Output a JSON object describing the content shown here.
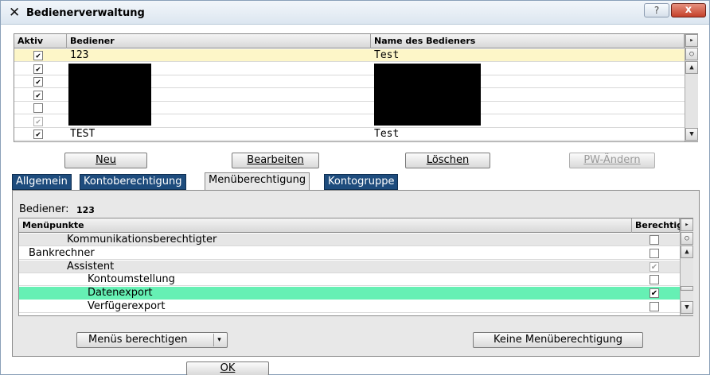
{
  "window": {
    "title": "Bedienerverwaltung",
    "help_label": "?",
    "close_label": "x"
  },
  "users_grid": {
    "columns": {
      "active": "Aktiv",
      "user": "Bediener",
      "name": "Name des Bedieners"
    },
    "rows": [
      {
        "active": true,
        "disabled": false,
        "user": "123",
        "name": "Test",
        "selected": true
      },
      {
        "active": true,
        "disabled": false,
        "user": "",
        "name": "",
        "selected": false
      },
      {
        "active": true,
        "disabled": false,
        "user": "",
        "name": "",
        "selected": false
      },
      {
        "active": true,
        "disabled": false,
        "user": "",
        "name": "",
        "selected": false
      },
      {
        "active": false,
        "disabled": false,
        "user": "",
        "name": "",
        "selected": false
      },
      {
        "active": true,
        "disabled": true,
        "user": "",
        "name": "",
        "selected": false
      },
      {
        "active": true,
        "disabled": false,
        "user": "TEST",
        "name": "Test",
        "selected": false
      }
    ]
  },
  "actions": {
    "new": "Neu",
    "edit": "Bearbeiten",
    "delete": "Löschen",
    "pw_change": "PW-Ändern"
  },
  "tabs": [
    {
      "label": "Allgemein",
      "active": false
    },
    {
      "label": "Kontoberechtigung",
      "active": false
    },
    {
      "label": "Menüberechtigung",
      "active": true
    },
    {
      "label": "Kontogruppe",
      "active": false
    }
  ],
  "panel": {
    "user_label": "Bediener:",
    "user_value": "123",
    "menu_grid": {
      "columns": {
        "item": "Menüpunkte",
        "allowed": "Berechtigt"
      },
      "rows": [
        {
          "label": "Kommunikationsberechtigter",
          "allowed": false,
          "disabled": false,
          "selected": false
        },
        {
          "label": "Bankrechner",
          "allowed": false,
          "disabled": false,
          "selected": false
        },
        {
          "label": "Assistent",
          "allowed": true,
          "disabled": true,
          "selected": false
        },
        {
          "label": "Kontoumstellung",
          "allowed": false,
          "disabled": false,
          "selected": false
        },
        {
          "label": "Datenexport",
          "allowed": true,
          "disabled": false,
          "selected": true
        },
        {
          "label": "Verfügerexport",
          "allowed": false,
          "disabled": false,
          "selected": false
        }
      ]
    },
    "grant_menus": "Menüs berechtigen",
    "no_menu_perm": "Keine Menüberechtigung"
  },
  "ok_label": "OK",
  "colors": {
    "tab_blue": "#1e4c7d",
    "selected_row": "#fdf6c8",
    "highlight_row": "#66f0b4"
  }
}
